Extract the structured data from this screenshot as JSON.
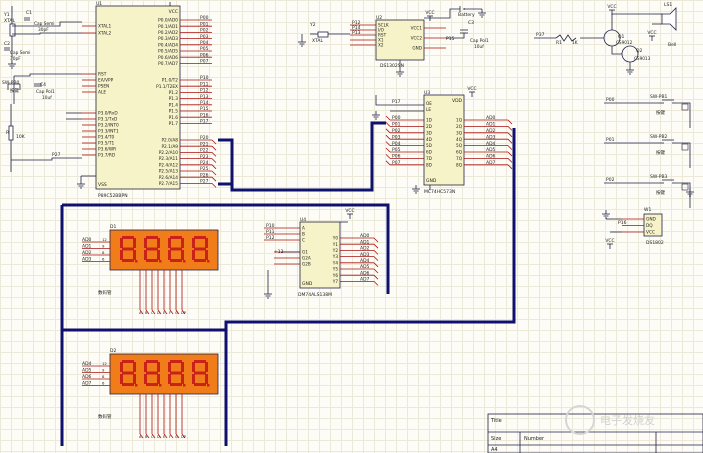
{
  "colors": {
    "wire": "#222244",
    "body": "#f7f3c8",
    "bus": "#10106e",
    "pinred": "#aa1111",
    "seg_bg": "#f07d1a",
    "seg_fg": "#c8221a",
    "label": "#222222"
  },
  "mcu": {
    "ref": "U1",
    "part": "P89C52BBPN",
    "left_pins": [
      "XTAL1",
      "XTAL2",
      "RST",
      "EA/VPP",
      "PSEN",
      "ALE",
      "P3.0/RxD",
      "P3.1/TxD",
      "P3.2/INT0",
      "P3.3/INT1",
      "P3.4/T0",
      "P3.5/T1",
      "P3.6/WR",
      "P3.7/RD"
    ],
    "right_pins": [
      "P0.0/AD0",
      "P0.1/AD1",
      "P0.2/AD2",
      "P0.3/AD3",
      "P0.4/AD4",
      "P0.5/AD5",
      "P0.6/AD6",
      "P0.7/AD7",
      "P1.0/T2",
      "P1.1/T2EX",
      "P1.2",
      "P1.3",
      "P1.4",
      "P1.5",
      "P1.6",
      "P1.7",
      "P2.0/A8",
      "P2.1/A9",
      "P2.2/A10",
      "P2.3/A11",
      "P2.4/A12",
      "P2.5/A13",
      "P2.6/A14",
      "P2.7/A15"
    ],
    "vcc": "VCC",
    "vss": "VSS",
    "nets_p0": [
      "P00",
      "P01",
      "P02",
      "P03",
      "P04",
      "P05",
      "P06",
      "P07"
    ],
    "nets_p1": [
      "P10",
      "P11",
      "P12",
      "P13",
      "P14",
      "P15",
      "P16",
      "P17"
    ],
    "nets_p2": [
      "P20",
      "P21",
      "P22",
      "P23",
      "P24",
      "P25",
      "P26",
      "P27"
    ]
  },
  "osc": {
    "y1": "Y1",
    "y1_val": "XTAL",
    "c1": "C1",
    "c1_val": "Cap Semi",
    "c1_cap": "30pF",
    "c2": "C2",
    "c2_val": "Cap Semi",
    "c2_cap": "30pF"
  },
  "reset": {
    "sw": "SW-PB0",
    "sw_label": "按键",
    "c": "C4",
    "c_val": "Cap Pol1",
    "c_cap": "10uf",
    "r": "R",
    "r_val": "10K"
  },
  "rtc": {
    "ref": "U2",
    "part": "DS1302SN",
    "pins_l": [
      "SCLK",
      "I/O",
      "RST",
      "X1",
      "X2"
    ],
    "pins_r": [
      "VCC1",
      "VCC2",
      "GND"
    ],
    "y2": "Y2",
    "y2_val": "XTAL",
    "battery": "Battery",
    "c3": "C3",
    "c3_val": "Cap Pol1",
    "c3_cap": "10uf",
    "nets": [
      "P12",
      "P14",
      "P13"
    ],
    "vcc": "VCC"
  },
  "buzzer": {
    "ls": "LS1",
    "ls_label": "Bell",
    "q1": "Q1",
    "q1_part": "CS9012",
    "q2": "Q2",
    "q2_part": "CS9013",
    "r": "R1",
    "r_val": "1K",
    "net": "P37",
    "vcc": "VCC"
  },
  "latch": {
    "ref": "U3",
    "part": "MC74HC573N",
    "d_pins": [
      "1D",
      "2D",
      "3D",
      "4D",
      "5D",
      "6D",
      "7D",
      "8D"
    ],
    "q_pins": [
      "1Q",
      "2Q",
      "3Q",
      "4Q",
      "5Q",
      "6Q",
      "7Q",
      "8Q"
    ],
    "in_nets": [
      "P00",
      "P01",
      "P02",
      "P03",
      "P04",
      "P05",
      "P06",
      "P07"
    ],
    "out_nets": [
      "AD0",
      "AD1",
      "AD2",
      "AD3",
      "AD4",
      "AD5",
      "AD6",
      "AD7"
    ],
    "ctrl": [
      "OE",
      "LE"
    ],
    "vdd": "VDD",
    "gnd": "GND",
    "net_le": "P17"
  },
  "buttons": [
    {
      "ref": "SW-PB1",
      "label": "按键",
      "net": "P00"
    },
    {
      "ref": "SW-PB2",
      "label": "按键",
      "net": "P01"
    },
    {
      "ref": "SW-PB3",
      "label": "按键",
      "net": "P02"
    }
  ],
  "sensor": {
    "ref": "W1",
    "part": "DS1802",
    "pins": [
      "GND",
      "DQ",
      "VCC"
    ],
    "net": "P16",
    "vcc": "VCC"
  },
  "decoder": {
    "ref": "U4",
    "part": "DM74ALS138M",
    "in_pins": [
      "A",
      "B",
      "C"
    ],
    "en_pins": [
      "G1",
      "G2A",
      "G2B"
    ],
    "out_pins": [
      "Y0",
      "Y1",
      "Y2",
      "Y3",
      "Y4",
      "Y5",
      "Y6",
      "Y7"
    ],
    "in_nets": [
      "P10",
      "P11",
      "P12"
    ],
    "out_nets": [
      "AD0",
      "AD1",
      "AD2",
      "AD3",
      "AD4",
      "AD5",
      "AD6",
      "AD7"
    ],
    "vcc": "VCC",
    "gnd": "GND"
  },
  "displays": [
    {
      "ref": "D1",
      "label": "数码管",
      "digits": "8888",
      "nets": [
        "AD0",
        "AD1",
        "AD2",
        "AD3"
      ]
    },
    {
      "ref": "D2",
      "label": "数码管",
      "digits": "8888",
      "nets": [
        "AD4",
        "AD5",
        "AD6",
        "AD7"
      ]
    }
  ],
  "seg_pins": [
    "A",
    "B",
    "C",
    "D",
    "E",
    "F",
    "G",
    "DP"
  ],
  "title_block": {
    "title": "Title",
    "size": "Size",
    "size_val": "A4",
    "number": "Number"
  },
  "watermark": "电子发烧友"
}
